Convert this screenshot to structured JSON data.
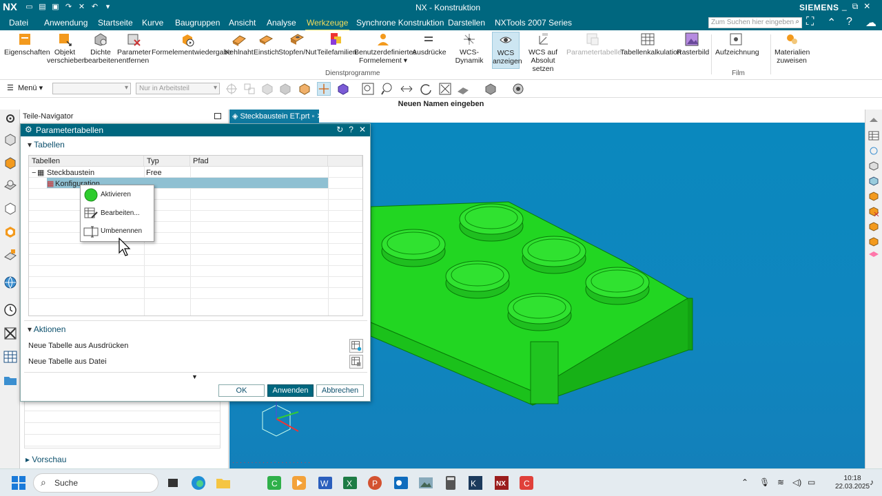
{
  "titlebar": {
    "logo": "NX",
    "title": "NX - Konstruktion",
    "brand": "SIEMENS"
  },
  "menubar": {
    "tabs": [
      "Datei",
      "Anwendung",
      "Startseite",
      "Kurve",
      "Baugruppen",
      "Ansicht",
      "Analyse",
      "Werkzeuge",
      "Synchrone Konstruktion",
      "Darstellen",
      "NXTools 2007 Series"
    ],
    "active_tab": "Werkzeuge",
    "search_placeholder": "Zum Suchen hier eingeben"
  },
  "ribbon": {
    "buttons": [
      {
        "label": "Eigenschaften",
        "label2": ""
      },
      {
        "label": "Objekt",
        "label2": "verschieben"
      },
      {
        "label": "Dichte",
        "label2": "bearbeiten"
      },
      {
        "label": "Parameter",
        "label2": "entfernen"
      },
      {
        "label": "Formelementwiedergabe",
        "label2": ""
      },
      {
        "label": "Kehlnaht",
        "label2": ""
      },
      {
        "label": "Einstich",
        "label2": ""
      },
      {
        "label": "Stopfen/Nut",
        "label2": ""
      },
      {
        "label": "Teilefamilien",
        "label2": ""
      },
      {
        "label": "Benutzerdefiniertes",
        "label2": "Formelement ▾"
      },
      {
        "label": "Ausdrücke",
        "label2": ""
      },
      {
        "label": "WCS-Dynamik",
        "label2": ""
      },
      {
        "label": "WCS",
        "label2": "anzeigen"
      },
      {
        "label": "WCS auf",
        "label2": "Absolut setzen"
      },
      {
        "label": "Parametertabellen",
        "label2": ""
      },
      {
        "label": "Tabellenkalkulation",
        "label2": ""
      },
      {
        "label": "Rasterbild",
        "label2": ""
      },
      {
        "label": "Aufzeichnung",
        "label2": ""
      },
      {
        "label": "Materialien",
        "label2": "zuweisen"
      }
    ],
    "group_dienstprogramme": "Dienstprogramme",
    "group_film": "Film"
  },
  "toolbar": {
    "menu_label": "Menü",
    "filter_placeholder": "Nur in Arbeitsteil"
  },
  "cue_line": "Neuen Namen eingeben",
  "navigator": {
    "title": "Teile-Navigator",
    "preview_label": "Vorschau"
  },
  "graphics": {
    "tab_label": "Steckbaustein ET.prt"
  },
  "dialog": {
    "title": "Parametertabellen",
    "section_tables": "Tabellen",
    "columns": [
      "Tabellen",
      "Typ",
      "Pfad"
    ],
    "rows": [
      {
        "name": "Steckbaustein",
        "type": "Free",
        "path": ""
      },
      {
        "name": "Konfiguration",
        "type": "",
        "path": ""
      }
    ],
    "section_actions": "Aktionen",
    "actions": [
      "Neue Tabelle aus Ausdrücken",
      "Neue Tabelle aus Datei"
    ],
    "buttons": {
      "ok": "OK",
      "apply": "Anwenden",
      "cancel": "Abbrechen"
    }
  },
  "context_menu": {
    "items": [
      "Aktivieren",
      "Bearbeiten...",
      "Umbenennen"
    ]
  },
  "taskbar": {
    "search_label": "Suche",
    "time": "10:18",
    "date": "22.03.2025"
  },
  "colors": {
    "nx_teal": "#00677f",
    "active_tab": "#f7dc5a",
    "model_green": "#1fd51f",
    "viewport_blue": "#0a88be"
  }
}
